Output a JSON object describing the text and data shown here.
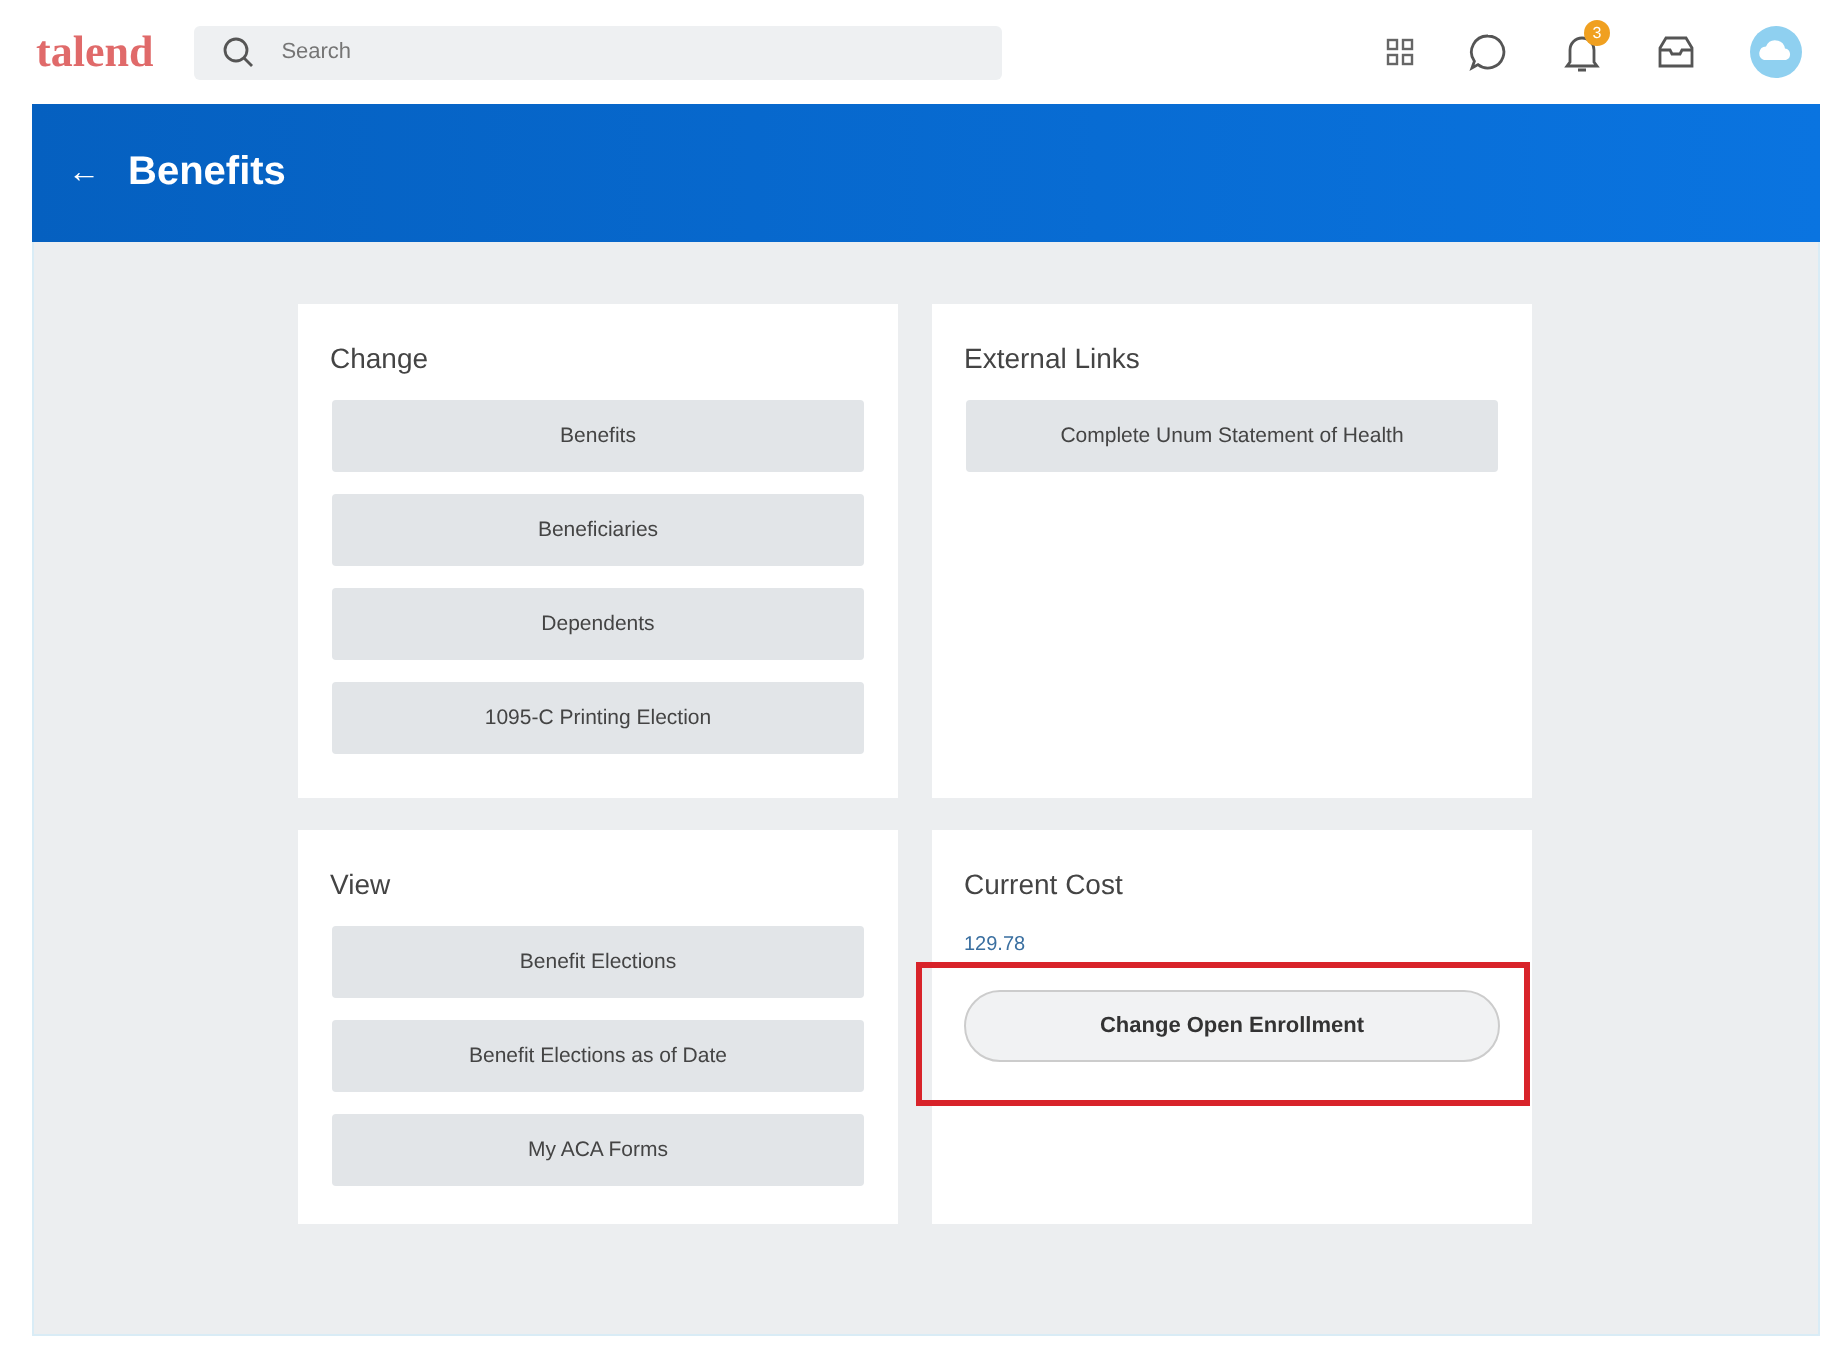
{
  "topbar": {
    "logo": "talend",
    "search": {
      "placeholder": "Search"
    },
    "notifications": "3"
  },
  "header": {
    "back": "←",
    "title": "Benefits"
  },
  "cards": [
    {
      "title": "Change",
      "kind": "buttons",
      "buttons": [
        "Benefits",
        "Beneficiaries",
        "Dependents",
        "1095-C Printing Election"
      ]
    },
    {
      "title": "External Links",
      "kind": "buttons",
      "buttons": [
        "Complete Unum Statement of Health"
      ]
    },
    {
      "title": "View",
      "kind": "buttons",
      "buttons": [
        "Benefit Elections",
        "Benefit Elections as of Date",
        "My ACA Forms"
      ]
    },
    {
      "title": "Current Cost",
      "kind": "cost",
      "amount": "129.78",
      "action": {
        "label": "Change Open Enrollment",
        "highlighted": true
      }
    }
  ]
}
